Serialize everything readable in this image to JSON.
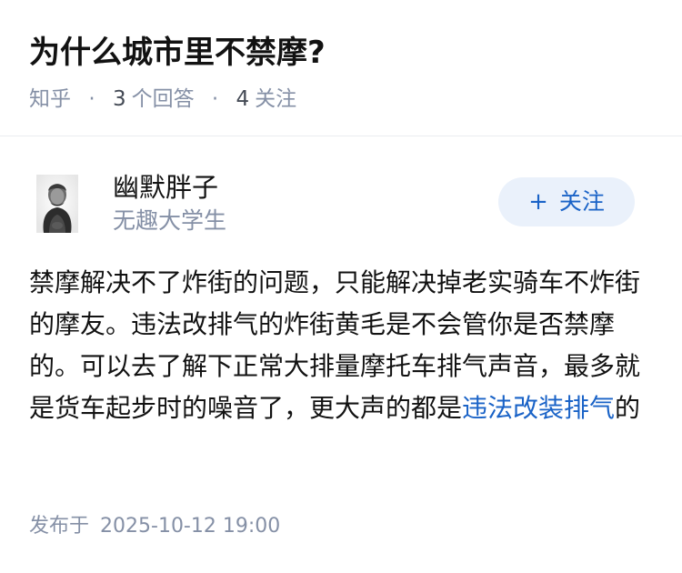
{
  "question": {
    "title": "为什么城市里不禁摩?",
    "source": "知乎",
    "answer_count": "3",
    "answer_label": "个回答",
    "follower_count": "4",
    "follower_label": "关注",
    "separator": "·"
  },
  "author": {
    "name": "幽默胖子",
    "bio": "无趣大学生",
    "avatar_icon": "user-avatar-icon",
    "follow_button": {
      "plus": "+",
      "label": "关注"
    }
  },
  "answer": {
    "text_before_link": "禁摩解决不了炸街的问题，只能解决掉老实骑车不炸街的摩友。违法改排气的炸街黄毛是不会管你是否禁摩的。可以去了解下正常大排量摩托车排气声音，最多就是货车起步时的噪音了，更大声的都是",
    "link_text": "违法改装排气",
    "text_after_link": "的"
  },
  "publish": {
    "label": "发布于",
    "datetime": "2025-10-12 19:00"
  },
  "colors": {
    "link": "#1a63c7",
    "follow_bg": "#eaf1fb",
    "meta_text": "#8590a6"
  }
}
